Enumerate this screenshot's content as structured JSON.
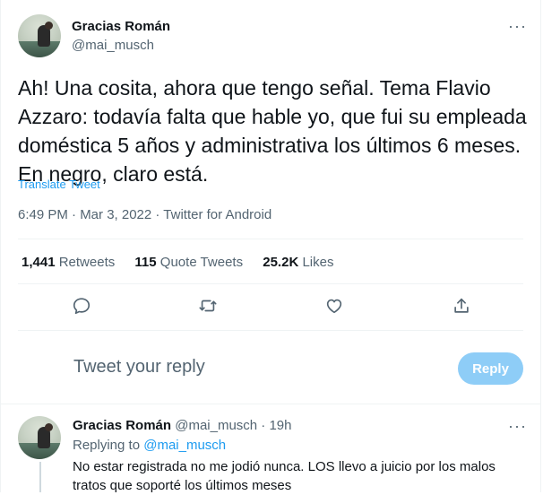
{
  "main_tweet": {
    "author_name": "Gracias Román",
    "author_handle": "@mai_musch",
    "more_label": "···",
    "text": "Ah! Una cosita, ahora que tengo señal. Tema Flavio Azzaro: todavía falta que hable yo, que fui su empleada doméstica 5 años y administrativa los últimos 6 meses. En negro, claro está.",
    "translate_label": "Translate Tweet",
    "timestamp": "6:49 PM · Mar 3, 2022 · Twitter for Android",
    "stats": {
      "retweets_count": "1,441",
      "retweets_label": "Retweets",
      "quotes_count": "115",
      "quotes_label": "Quote Tweets",
      "likes_count": "25.2K",
      "likes_label": "Likes"
    },
    "actions": [
      "reply-icon",
      "retweet-icon",
      "like-icon",
      "share-icon"
    ]
  },
  "composer": {
    "placeholder": "Tweet your reply",
    "button_label": "Reply",
    "button_color": "#8ecdf7"
  },
  "reply_tweet": {
    "author_name": "Gracias Román",
    "author_handle": "@mai_musch · 19h",
    "more_label": "···",
    "replying_prefix": "Replying to",
    "replying_handle": "@mai_musch",
    "text": "No estar registrada no me jodió nunca. LOS llevo a juicio por los malos tratos que soporté los últimos meses"
  },
  "colors": {
    "accent": "#1d9bf0",
    "secondary_text": "#536471",
    "primary_text": "#0f1419"
  }
}
